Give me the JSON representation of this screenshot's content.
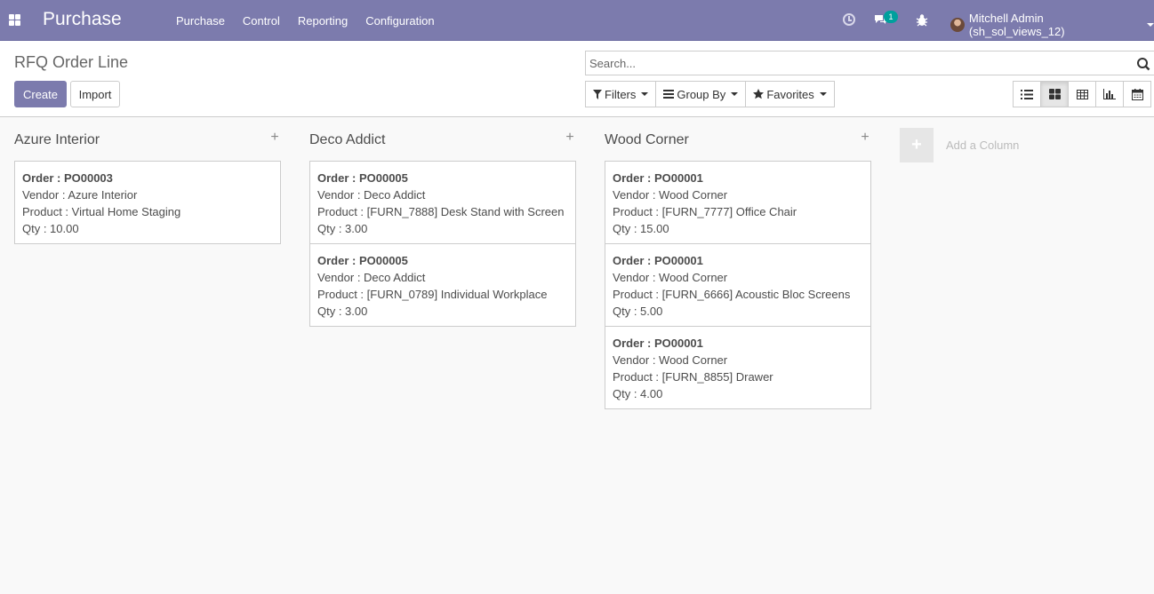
{
  "navbar": {
    "app_name": "Purchase",
    "menu": [
      "Purchase",
      "Control",
      "Reporting",
      "Configuration"
    ],
    "chat_badge": "1",
    "user_name": "Mitchell Admin (sh_sol_views_12)"
  },
  "control_panel": {
    "title": "RFQ Order Line",
    "create_label": "Create",
    "import_label": "Import",
    "search_placeholder": "Search...",
    "filters_label": "Filters",
    "group_by_label": "Group By",
    "favorites_label": "Favorites"
  },
  "kanban": {
    "add_column_label": "Add a Column",
    "columns": [
      {
        "title": "Azure Interior",
        "cards": [
          {
            "order": "Order : PO00003",
            "vendor": "Vendor : Azure Interior",
            "product": "Product : Virtual Home Staging",
            "qty": "Qty : 10.00"
          }
        ]
      },
      {
        "title": "Deco Addict",
        "cards": [
          {
            "order": "Order : PO00005",
            "vendor": "Vendor : Deco Addict",
            "product": "Product : [FURN_7888] Desk Stand with Screen",
            "qty": "Qty : 3.00"
          },
          {
            "order": "Order : PO00005",
            "vendor": "Vendor : Deco Addict",
            "product": "Product : [FURN_0789] Individual Workplace",
            "qty": "Qty : 3.00"
          }
        ]
      },
      {
        "title": "Wood Corner",
        "cards": [
          {
            "order": "Order : PO00001",
            "vendor": "Vendor : Wood Corner",
            "product": "Product : [FURN_7777] Office Chair",
            "qty": "Qty : 15.00"
          },
          {
            "order": "Order : PO00001",
            "vendor": "Vendor : Wood Corner",
            "product": "Product : [FURN_6666] Acoustic Bloc Screens",
            "qty": "Qty : 5.00"
          },
          {
            "order": "Order : PO00001",
            "vendor": "Vendor : Wood Corner",
            "product": "Product : [FURN_8855] Drawer",
            "qty": "Qty : 4.00"
          }
        ]
      }
    ]
  },
  "colors": {
    "brand": "#7c7bad",
    "badge": "#00a09d"
  }
}
